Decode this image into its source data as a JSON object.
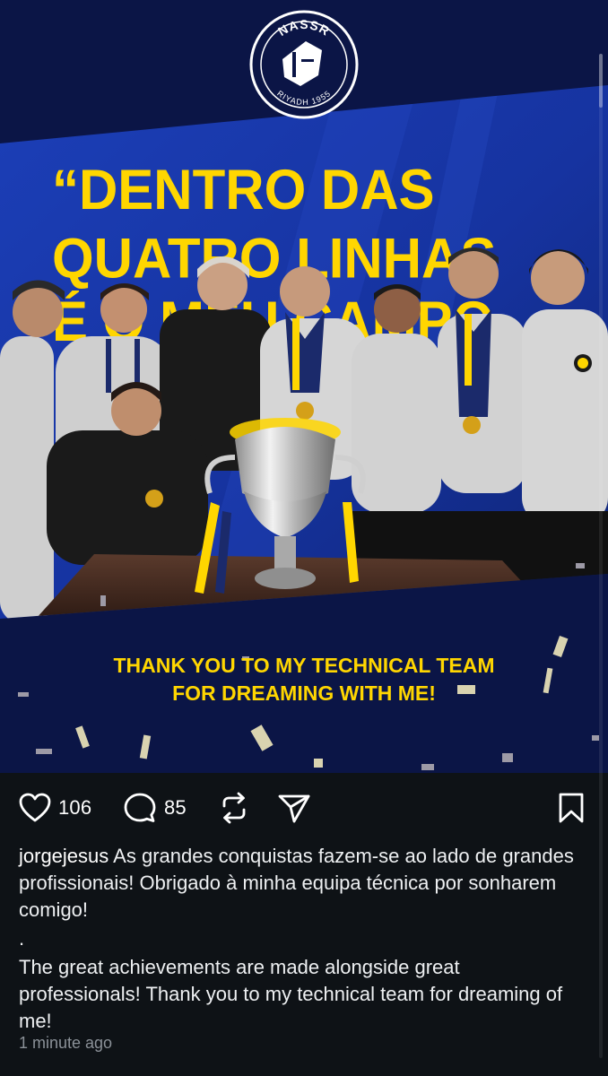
{
  "post": {
    "logo": {
      "top_text": "NASSR",
      "bottom_text": "RIYADH 1955"
    },
    "banner_quote": {
      "line1": "“DENTRO DAS",
      "line2": "QUATRO LINHAS",
      "line3": "É O MEU CAMPO"
    },
    "thank_you": {
      "line1": "THANK YOU TO MY TECHNICAL TEAM",
      "line2": "FOR DREAMING WITH ME!"
    },
    "colors": {
      "navy": "#0b1546",
      "blue_wall": "#1738a8",
      "yellow": "#ffd600",
      "shirt_grey": "#d8d8d8",
      "table_wood": "#4a2e22"
    }
  },
  "actions": {
    "likes": "106",
    "comments": "85",
    "icons": [
      "heart-icon",
      "comment-icon",
      "repost-icon",
      "share-icon",
      "bookmark-icon"
    ]
  },
  "caption": {
    "username": "jorgejesus",
    "text_pt": " As grandes conquistas fazem-se ao lado de grandes profissionais! Obrigado à minha equipa técnica por sonharem comigo!",
    "separator": ".",
    "text_en": "The great achievements are made alongside great professionals! Thank you to my technical team for dreaming of me!"
  },
  "timestamp": "1 minute ago"
}
